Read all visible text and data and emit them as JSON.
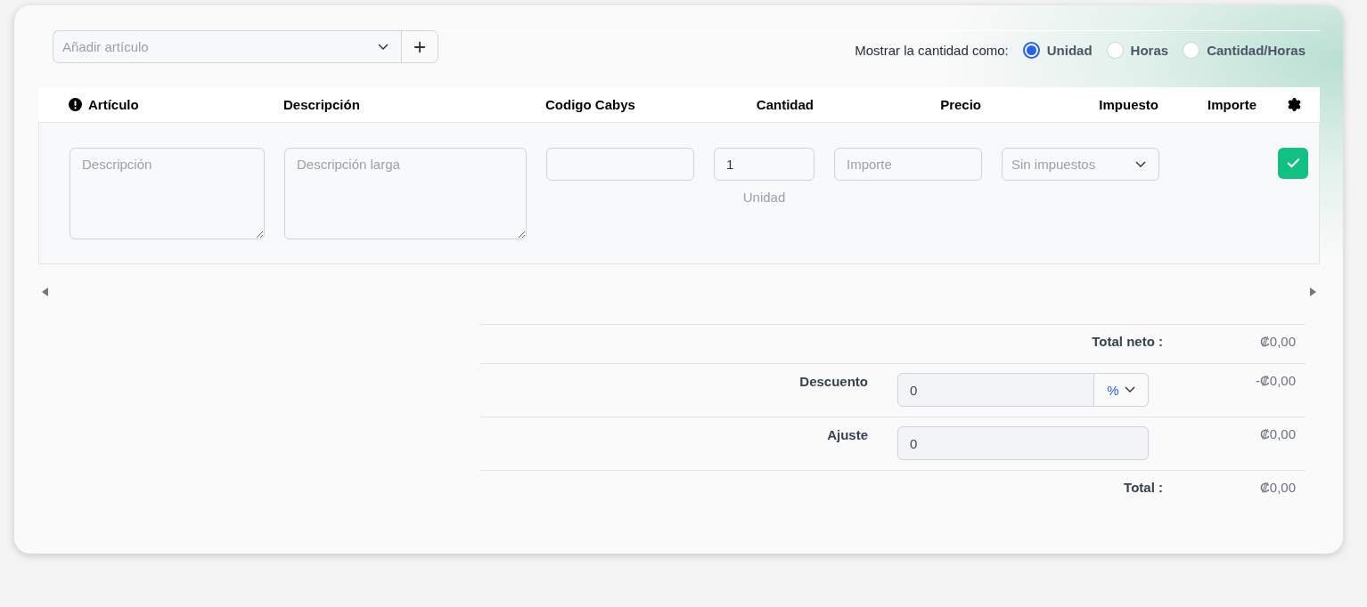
{
  "add_item": {
    "placeholder": "Añadir artículo"
  },
  "quantity_mode": {
    "label": "Mostrar la cantidad como:",
    "options": [
      {
        "label": "Unidad",
        "selected": true
      },
      {
        "label": "Horas",
        "selected": false
      },
      {
        "label": "Cantidad/Horas",
        "selected": false
      }
    ]
  },
  "table": {
    "columns": [
      {
        "label": "Artículo"
      },
      {
        "label": "Descripción"
      },
      {
        "label": "Codigo Cabys"
      },
      {
        "label": "Cantidad"
      },
      {
        "label": "Precio"
      },
      {
        "label": "Impuesto"
      },
      {
        "label": "Importe"
      }
    ],
    "new_row": {
      "description_placeholder": "Descripción",
      "long_description_placeholder": "Descripción larga",
      "quantity": "1",
      "unit": "Unidad",
      "price_placeholder": "Importe",
      "tax": "Sin impuestos"
    }
  },
  "totals": [
    {
      "kind": "total",
      "label": "Total neto :",
      "value": "₡0,00"
    },
    {
      "kind": "discount",
      "label": "Descuento",
      "input": "0",
      "unit": "%",
      "value": "-₡0,00"
    },
    {
      "kind": "adjust",
      "label": "Ajuste",
      "input": "0",
      "value": "₡0,00"
    },
    {
      "kind": "total",
      "label": "Total :",
      "value": "₡0,00"
    }
  ]
}
